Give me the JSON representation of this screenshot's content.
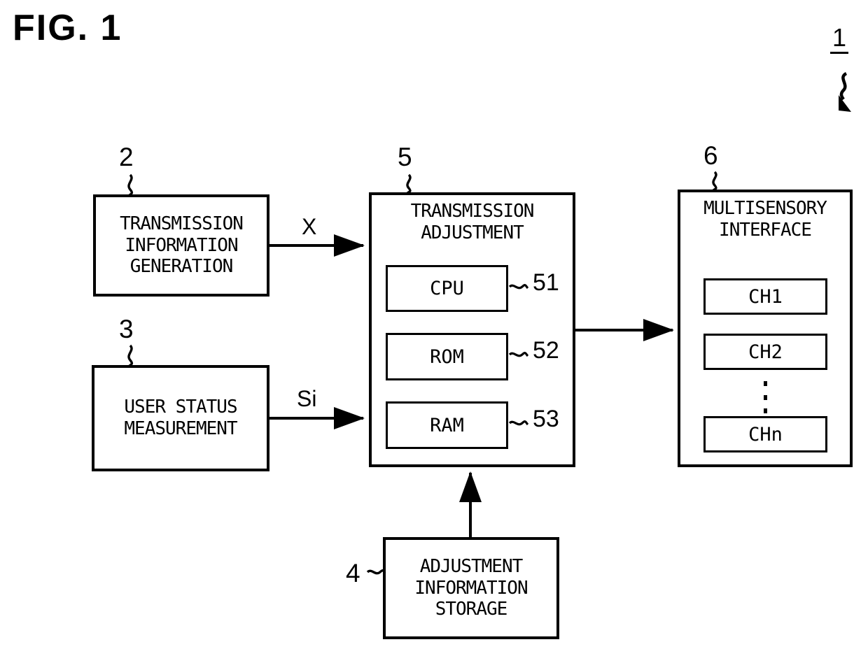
{
  "figure": {
    "title": "FIG. 1",
    "system_ref": "1"
  },
  "blocks": {
    "transmission_information_generation": {
      "ref": "2",
      "lines": [
        "TRANSMISSION",
        "INFORMATION",
        "GENERATION"
      ]
    },
    "user_status_measurement": {
      "ref": "3",
      "lines": [
        "USER STATUS",
        "MEASUREMENT"
      ]
    },
    "adjustment_information_storage": {
      "ref": "4",
      "lines": [
        "ADJUSTMENT",
        "INFORMATION",
        "STORAGE"
      ]
    },
    "transmission_adjustment": {
      "ref": "5",
      "lines": [
        "TRANSMISSION",
        "ADJUSTMENT"
      ],
      "components": [
        {
          "label": "CPU",
          "ref": "51"
        },
        {
          "label": "ROM",
          "ref": "52"
        },
        {
          "label": "RAM",
          "ref": "53"
        }
      ]
    },
    "multisensory_interface": {
      "ref": "6",
      "lines": [
        "MULTISENSORY",
        "INTERFACE"
      ],
      "channels": [
        {
          "label": "CH1"
        },
        {
          "label": "CH2"
        },
        {
          "label": "CHn"
        }
      ],
      "ellipsis": "⋮"
    }
  },
  "signals": {
    "transmission_information": "X",
    "user_status": "Si"
  }
}
